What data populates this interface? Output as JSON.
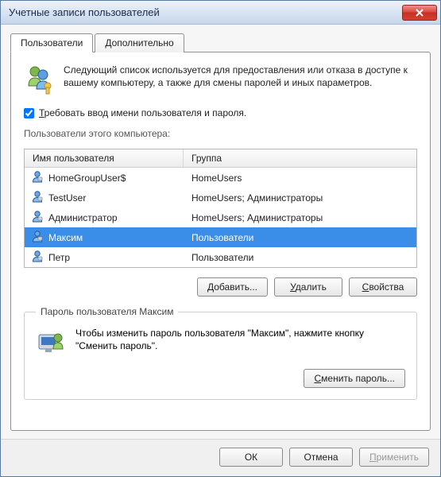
{
  "window": {
    "title": "Учетные записи пользователей"
  },
  "tabs": {
    "users": "Пользователи",
    "advanced": "Дополнительно"
  },
  "intro": {
    "text": "Следующий список используется для предоставления или отказа в доступе к вашему компьютеру, а также для смены паролей и иных параметров."
  },
  "require_login": {
    "checked": true,
    "accesskey": "Т",
    "label_rest": "ребовать ввод имени пользователя и пароля."
  },
  "list_label": "Пользователи этого компьютера:",
  "columns": {
    "name": "Имя пользователя",
    "group": "Группа"
  },
  "users": [
    {
      "name": "HomeGroupUser$",
      "group": "HomeUsers",
      "selected": false
    },
    {
      "name": "TestUser",
      "group": "HomeUsers; Администраторы",
      "selected": false
    },
    {
      "name": "Администратор",
      "group": "HomeUsers; Администраторы",
      "selected": false
    },
    {
      "name": "Максим",
      "group": "Пользователи",
      "selected": true
    },
    {
      "name": "Петр",
      "group": "Пользователи",
      "selected": false
    }
  ],
  "buttons": {
    "add_ak": "Д",
    "add_rest": "обавить...",
    "remove_ak": "У",
    "remove_rest": "далить",
    "properties_ak": "С",
    "properties_rest": "войства",
    "change_pw_ak": "С",
    "change_pw_rest": "менить пароль...",
    "ok": "ОК",
    "cancel": "Отмена",
    "apply_ak": "П",
    "apply_rest": "рименить"
  },
  "password_box": {
    "legend": "Пароль пользователя Максим",
    "text": "Чтобы изменить пароль пользователя \"Максим\", нажмите кнопку \"Сменить пароль\"."
  }
}
